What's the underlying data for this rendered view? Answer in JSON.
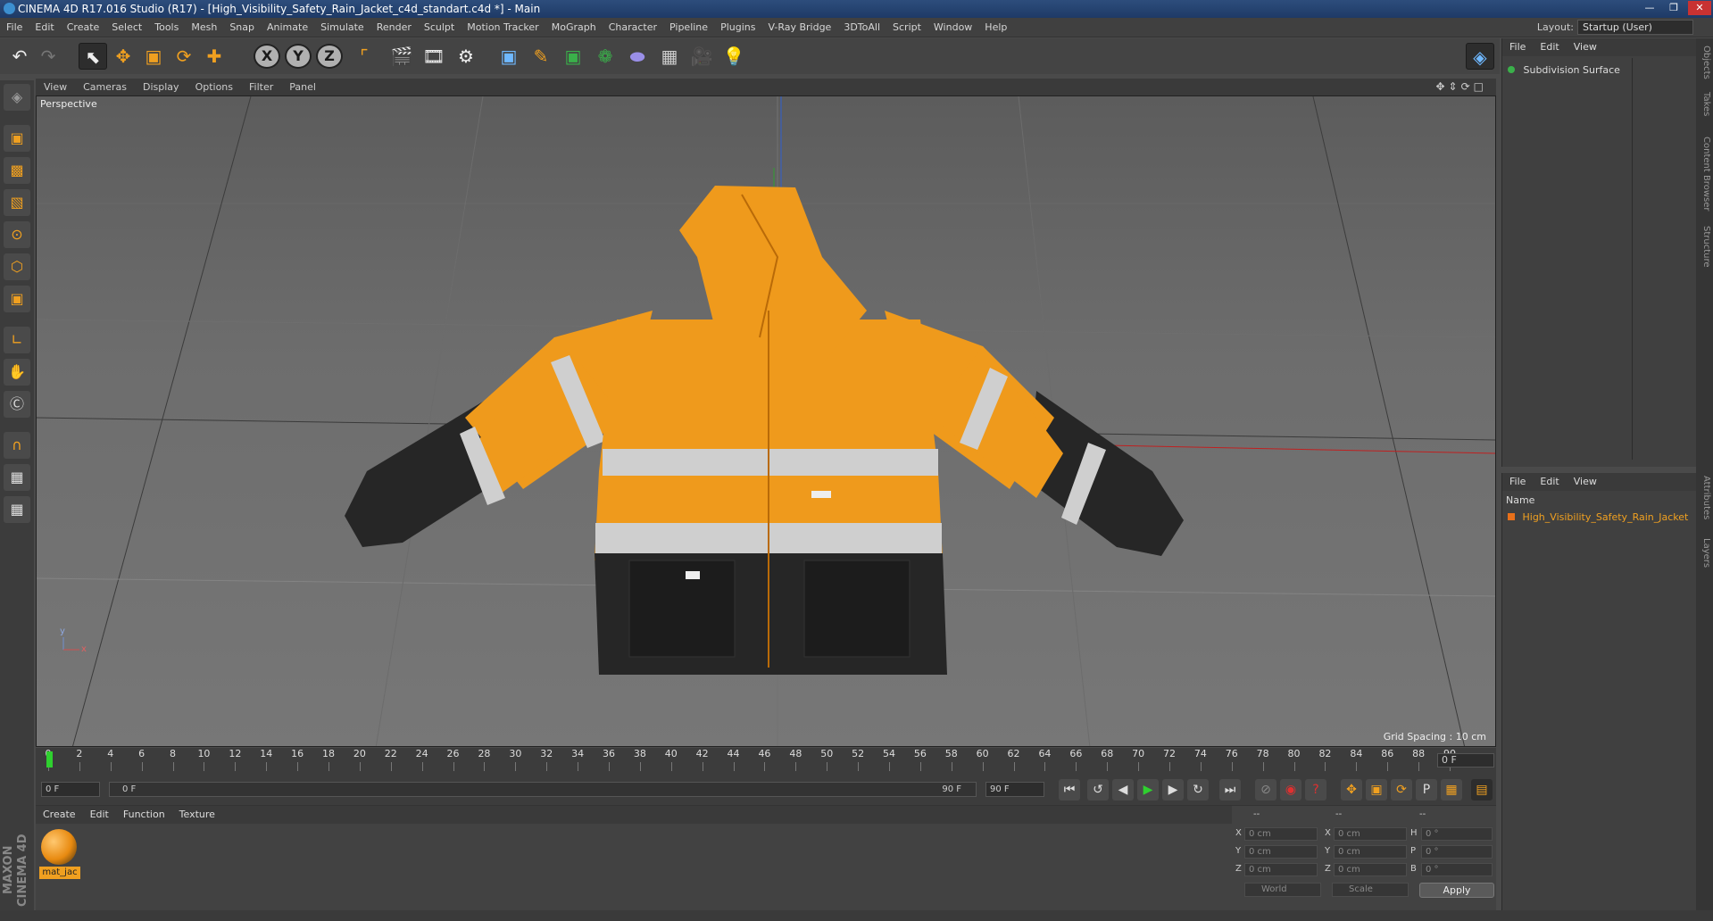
{
  "window": {
    "title": "CINEMA 4D R17.016 Studio (R17) - [High_Visibility_Safety_Rain_Jacket_c4d_standart.c4d *] - Main",
    "controls": [
      "minimize-icon",
      "restore-icon",
      "close-icon"
    ]
  },
  "menubar": {
    "items": [
      "File",
      "Edit",
      "Create",
      "Select",
      "Tools",
      "Mesh",
      "Snap",
      "Animate",
      "Simulate",
      "Render",
      "Sculpt",
      "Motion Tracker",
      "MoGraph",
      "Character",
      "Pipeline",
      "Plugins",
      "V-Ray Bridge",
      "3DToAll",
      "Script",
      "Window",
      "Help"
    ],
    "layout_label": "Layout:",
    "layout_value": "Startup (User)"
  },
  "toolbar": {
    "icons": [
      "undo-icon",
      "redo-icon",
      "select-pointer-icon",
      "move-icon",
      "scale-icon",
      "rotate-icon",
      "live-move-icon",
      "x-axis-lock",
      "y-axis-lock",
      "z-axis-lock",
      "coordinate-system-icon",
      "render-view-icon",
      "render-picture-viewer-icon",
      "render-settings-icon",
      "cube-primitive-icon",
      "spline-pen-icon",
      "subdivision-surface-icon",
      "cloner-icon",
      "deformer-icon",
      "floor-icon",
      "camera-icon",
      "light-icon",
      "python-icon"
    ],
    "axis_labels": [
      "X",
      "Y",
      "Z"
    ]
  },
  "left_toolbar": {
    "icons": [
      "make-editable-icon",
      "model-mode-icon",
      "texture-mode-icon",
      "workplane-icon",
      "points-mode-icon",
      "edges-mode-icon",
      "polygons-mode-icon",
      "axis-mode-icon",
      "tweak-icon",
      "snap-icon",
      "magnet-icon",
      "grid-lock-icon",
      "animation-mode-icon"
    ],
    "brand": "MAXON CINEMA 4D"
  },
  "viewport": {
    "menu": [
      "View",
      "Cameras",
      "Display",
      "Options",
      "Filter",
      "Panel"
    ],
    "label": "Perspective",
    "grid_spacing": "Grid Spacing : 10 cm",
    "axis_y": "y",
    "axis_x": "x"
  },
  "timeline": {
    "ticks": [
      "0",
      "2",
      "4",
      "6",
      "8",
      "10",
      "12",
      "14",
      "16",
      "18",
      "20",
      "22",
      "24",
      "26",
      "28",
      "30",
      "32",
      "34",
      "36",
      "38",
      "40",
      "42",
      "44",
      "46",
      "48",
      "50",
      "52",
      "54",
      "56",
      "58",
      "60",
      "62",
      "64",
      "66",
      "68",
      "70",
      "72",
      "74",
      "76",
      "78",
      "80",
      "82",
      "84",
      "86",
      "88",
      "90"
    ],
    "current_frame": "0 F",
    "playhead_frame": 0
  },
  "transport": {
    "start": "0 F",
    "range_start": "0 F",
    "range_end": "90 F",
    "end": "90 F",
    "buttons": [
      "go-to-start-icon",
      "prev-key-icon",
      "play-reverse-icon",
      "play-icon",
      "next-key-icon",
      "loop-icon",
      "go-to-end-icon",
      "record-keys-icon",
      "auto-key-icon",
      "keyframe-selection-icon",
      "move-key-icon",
      "scale-key-icon",
      "rotate-key-icon",
      "param-key-icon",
      "pla-key-icon",
      "timeline-window-icon"
    ]
  },
  "materials": {
    "menu": [
      "Create",
      "Edit",
      "Function",
      "Texture"
    ],
    "items": [
      {
        "name": "mat_jac"
      }
    ]
  },
  "coordinates": {
    "headers": [
      "--",
      "--",
      "--"
    ],
    "rows": [
      {
        "l1": "X",
        "v1": "0 cm",
        "l2": "X",
        "v2": "0 cm",
        "l3": "H",
        "v3": "0 °"
      },
      {
        "l1": "Y",
        "v1": "0 cm",
        "l2": "Y",
        "v2": "0 cm",
        "l3": "P",
        "v3": "0 °"
      },
      {
        "l1": "Z",
        "v1": "0 cm",
        "l2": "Z",
        "v2": "0 cm",
        "l3": "B",
        "v3": "0 °"
      }
    ],
    "space": "World",
    "mode": "Scale",
    "apply": "Apply"
  },
  "objects": {
    "menu": [
      "File",
      "Edit",
      "View"
    ],
    "items": [
      {
        "name": "Subdivision Surface",
        "color": "#3ab04a"
      }
    ]
  },
  "layers": {
    "menu": [
      "File",
      "Edit",
      "View"
    ],
    "name_header": "Name",
    "items": [
      {
        "name": "High_Visibility_Safety_Rain_Jacket",
        "color": "#e8701a"
      }
    ]
  },
  "right_tabs": [
    "Objects",
    "Takes",
    "Content Browser",
    "Structure",
    "Attributes",
    "Layers"
  ],
  "colors": {
    "accent": "#f0a020",
    "jacket_orange": "#ef9a1c",
    "reflective": "#cfcfcf",
    "dark": "#262626"
  }
}
